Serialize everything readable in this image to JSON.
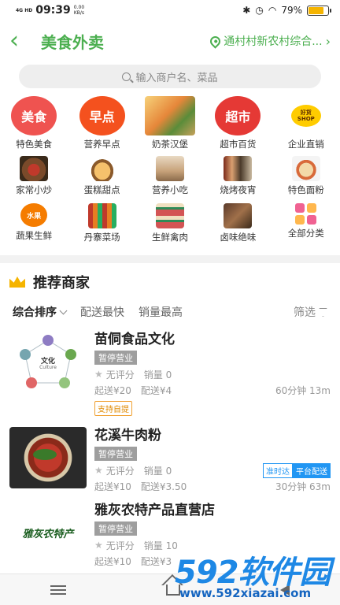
{
  "status_bar": {
    "signal": "4G HD",
    "time": "09:39",
    "net_speed": "0.00",
    "net_unit": "KB/s",
    "icons": [
      "bluetooth-icon",
      "alarm-icon",
      "wifi-icon"
    ],
    "battery": "79%",
    "battery_level": 0.79
  },
  "header": {
    "title": "美食外卖",
    "location": "通村村新农村综合...",
    "back_icon": "chevron-left-icon",
    "accent": "#4caf50"
  },
  "search": {
    "placeholder": "输入商户名、菜品"
  },
  "categories": [
    {
      "label": "特色美食",
      "icon_text": "美食"
    },
    {
      "label": "营养早点",
      "icon_text": "早点"
    },
    {
      "label": "奶茶汉堡",
      "icon_text": ""
    },
    {
      "label": "超市百货",
      "icon_text": "超市"
    },
    {
      "label": "企业直销",
      "icon_text": "好货 SHOP"
    },
    {
      "label": "家常小炒",
      "icon_text": ""
    },
    {
      "label": "蛋糕甜点",
      "icon_text": ""
    },
    {
      "label": "营养小吃",
      "icon_text": ""
    },
    {
      "label": "烧烤夜宵",
      "icon_text": ""
    },
    {
      "label": "特色面粉",
      "icon_text": ""
    },
    {
      "label": "蔬果生鲜",
      "icon_text": "水果"
    },
    {
      "label": "丹寨菜场",
      "icon_text": ""
    },
    {
      "label": "生鲜禽肉",
      "icon_text": ""
    },
    {
      "label": "卤味绝味",
      "icon_text": ""
    },
    {
      "label": "全部分类",
      "icon_text": ""
    }
  ],
  "recommend": {
    "title": "推荐商家"
  },
  "sort": {
    "options": [
      "综合排序",
      "配送最快",
      "销量最高"
    ],
    "filter": "筛选"
  },
  "shops": [
    {
      "name": "苗侗食品文化",
      "status": "暂停营业",
      "rating": "无评分",
      "sales": "销量 0",
      "min_order": "起送¥20",
      "delivery_fee": "配送¥4",
      "eta": "60分钟 13m",
      "tag": "支持自提",
      "image_text": "文化",
      "image_subtext": "Culture"
    },
    {
      "name": "花溪牛肉粉",
      "status": "暂停营业",
      "rating": "无评分",
      "sales": "销量 0",
      "min_order": "起送¥10",
      "delivery_fee": "配送¥3.50",
      "eta": "30分钟 63m",
      "badge_on_time": "准时达",
      "badge_platform": "平台配送"
    },
    {
      "name": "雅灰农特产品直营店",
      "status": "暂停营业",
      "rating": "无评分",
      "sales": "销量 10",
      "min_order": "起送¥10",
      "delivery_fee": "配送¥3",
      "image_text": "雅灰农特产"
    }
  ],
  "watermark": {
    "logo": "592软件园",
    "url": "www.592xiazai.com"
  }
}
